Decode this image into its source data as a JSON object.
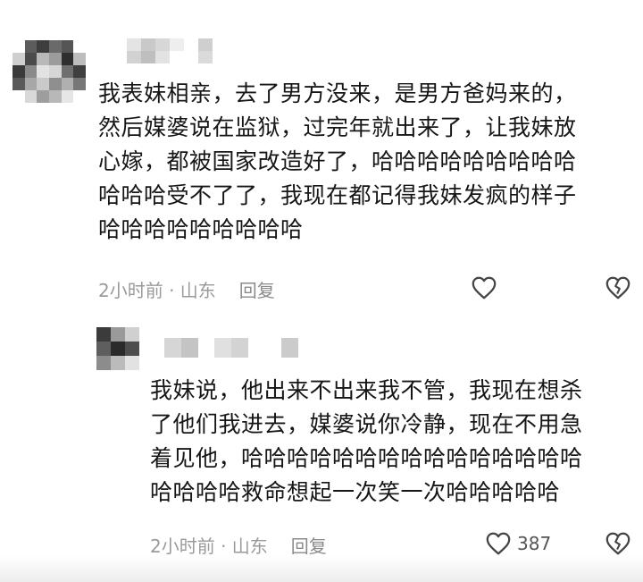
{
  "comments": [
    {
      "lines": [
        "我表妹相亲，去了男方没来，是男方爸妈来的，",
        "然后媒婆说在监狱，过完年就出来了，让我妹放",
        "心嫁，都被国家改造好了，哈哈哈哈哈哈哈哈哈",
        "哈哈哈受不了了，我现在都记得我妹发疯的样子",
        "哈哈哈哈哈哈哈哈哈"
      ],
      "time_location": "2小时前 · 山东",
      "reply_label": "回复",
      "like_count": ""
    },
    {
      "lines": [
        "我妹说，他出来不出来我不管，我现在想杀",
        "了他们我进去，媒婆说你冷静，现在不用急",
        "着见他，哈哈哈哈哈哈哈哈哈哈哈哈哈哈哈",
        "哈哈哈哈救命想起一次笑一次哈哈哈哈哈"
      ],
      "time_location": "2小时前 · 山东",
      "reply_label": "回复",
      "like_count": "387"
    }
  ],
  "icons": {
    "like": "heart-outline-icon",
    "dislike": "broken-heart-icon"
  },
  "colors": {
    "text": "#161616",
    "meta": "#9a9a9a",
    "icon": "#444444"
  }
}
